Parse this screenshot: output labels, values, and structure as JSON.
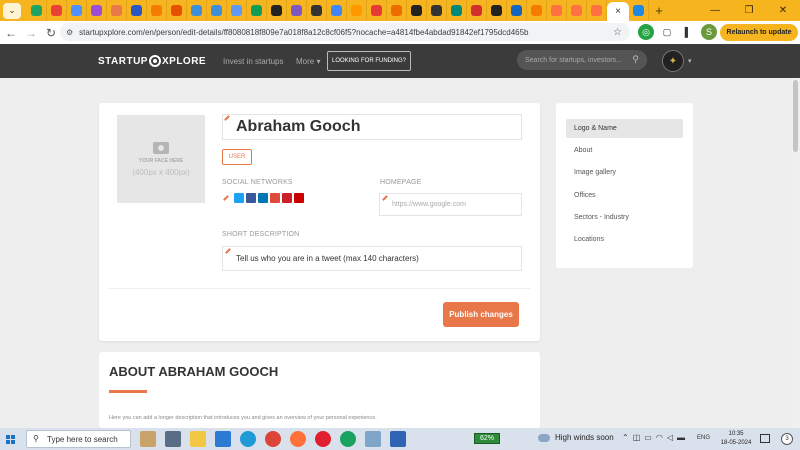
{
  "browser": {
    "url": "startupxplore.com/en/person/edit-details/ff8080818f809e7a018f8a12c8cf06f5?nocache=a4814fbe4abdad91842ef1795dcd465b",
    "active_tab_close": "×",
    "new_tab": "+",
    "relaunch_label": "Relaunch to update",
    "profile_letter": "S"
  },
  "site": {
    "logo_left": "STARTUP",
    "logo_right": "XPLORE",
    "nav_invest": "Invest in startups",
    "nav_more": "More",
    "nav_funding": "LOOKING FOR FUNDING?",
    "search_placeholder": "Search for startups, investors..."
  },
  "profile": {
    "photo_line1": "YOUR FACE HERE",
    "photo_line2": "(400px x 400px)",
    "name": "Abraham Gooch",
    "role_tag": "USER",
    "social_label": "SOCIAL NETWORKS",
    "homepage_label": "HOMEPAGE",
    "homepage_placeholder": "https://www.google.com",
    "short_desc_label": "SHORT DESCRIPTION",
    "short_desc_placeholder": "Tell us who you are in a tweet (max 140 characters)",
    "publish_label": "Publish changes"
  },
  "sidenav": {
    "items": [
      {
        "label": "Logo & Name"
      },
      {
        "label": "About"
      },
      {
        "label": "Image gallery"
      },
      {
        "label": "Offices"
      },
      {
        "label": "Sectors - Industry"
      },
      {
        "label": "Locations"
      }
    ]
  },
  "about": {
    "title": "ABOUT ABRAHAM GOOCH",
    "description": "Here you can add a longer description that introduces you and gives an overview of your personal experience."
  },
  "taskbar": {
    "search_placeholder": "Type here to search",
    "battery": "62%",
    "weather": "High winds soon",
    "lang": "ENG",
    "time": "10:35",
    "date": "18-05-2024",
    "notif_count": "3"
  },
  "colors": {
    "accent": "#e8774a",
    "chrome_tab": "#f6b41e",
    "site_header": "#3b3b3b"
  }
}
